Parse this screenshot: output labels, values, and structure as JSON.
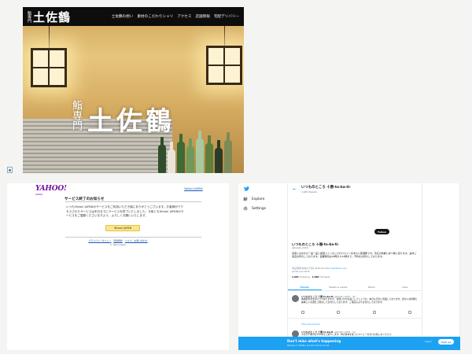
{
  "hero": {
    "brand_small": "鮨専門",
    "brand_big": "土佐鶴",
    "nav": [
      "土佐鶴の想い",
      "素材のこだわりシャリ",
      "アクセス",
      "店舗情報",
      "宅配デリバリー"
    ],
    "sub_title": "鮨専門",
    "title": "土佐鶴"
  },
  "yahoo": {
    "logo": "YAHOO!",
    "logo_sub": "JAPAN",
    "top_link": "Yahoo! JAPAN",
    "heading": "サービス終了のお知らせ",
    "body": "いつもYahoo! JAPANのサービスをご利用いただき誠にありがとうございます。お客様がアクセスされたサービスは本日までにサービスを終了いたしました。今後ともYahoo! JAPANのサービスをご愛顧くださいますよう、よろしくお願いいたします。",
    "button": "Yahoo! JAPAN",
    "footer_links": [
      "プライバシーポリシー",
      "利用規約",
      "ヘルプ・お問い合わせ"
    ],
    "copyright": "© Yahoo Japan"
  },
  "twitter": {
    "nav": [
      {
        "icon": "hash-icon",
        "label": "Explore"
      },
      {
        "icon": "gear-icon",
        "label": "Settings"
      }
    ],
    "header_name": "いつものところ 十勝-to-ka-ti-",
    "header_count": "1,680 Tweets",
    "follow": "Follow",
    "profile_name": "いつものところ 十勝-to-ka-ti-",
    "profile_handle": "@tokati_2015",
    "bio": "道東におまかせ一品一品と厳選メインのこだわりワインを中心に居酒屋です。帯広の新鮮に食べ物と創ります。是非ご来店お待ちしております。営業時間は18時から24時まで。予約をお待ちしております。",
    "meta_location": "帯広市西1条南10丁目1",
    "meta_phone": "0155-22-1710",
    "meta_link": "mytokachi.com",
    "meta_joined": "Joined June 2015",
    "stats": {
      "following": "1,081",
      "following_label": "Following",
      "followers": "1,080",
      "followers_label": "Followers"
    },
    "tabs": [
      "Tweets",
      "Tweets & replies",
      "Media",
      "Likes"
    ],
    "tweets": [
      {
        "name": "いつものところ 十勝-to-ka-ti-",
        "handle": "@tokati_2015 · 4h",
        "text": "本格的な冬を迎えつつありますが、皆様いかがお過ごしでしょうか。本日も元気に営業しております。温かいお料理と美味しいお酒をご用意してお待ちしております。ご来店心よりお待ちしております。"
      },
      {
        "name": "いつものところ 十勝-to-ka-ti-",
        "handle": "@tokati_2015 · 1d",
        "text": "今日の十勝のおすすめをご紹介します。旬の食材を使ったメニューをぜひお楽しみください。"
      }
    ],
    "show_thread": "Show this thread",
    "bottom_title": "Don't miss what's happening",
    "bottom_sub": "People on Twitter are the first to know.",
    "login": "Log in",
    "signup": "Sign up"
  }
}
